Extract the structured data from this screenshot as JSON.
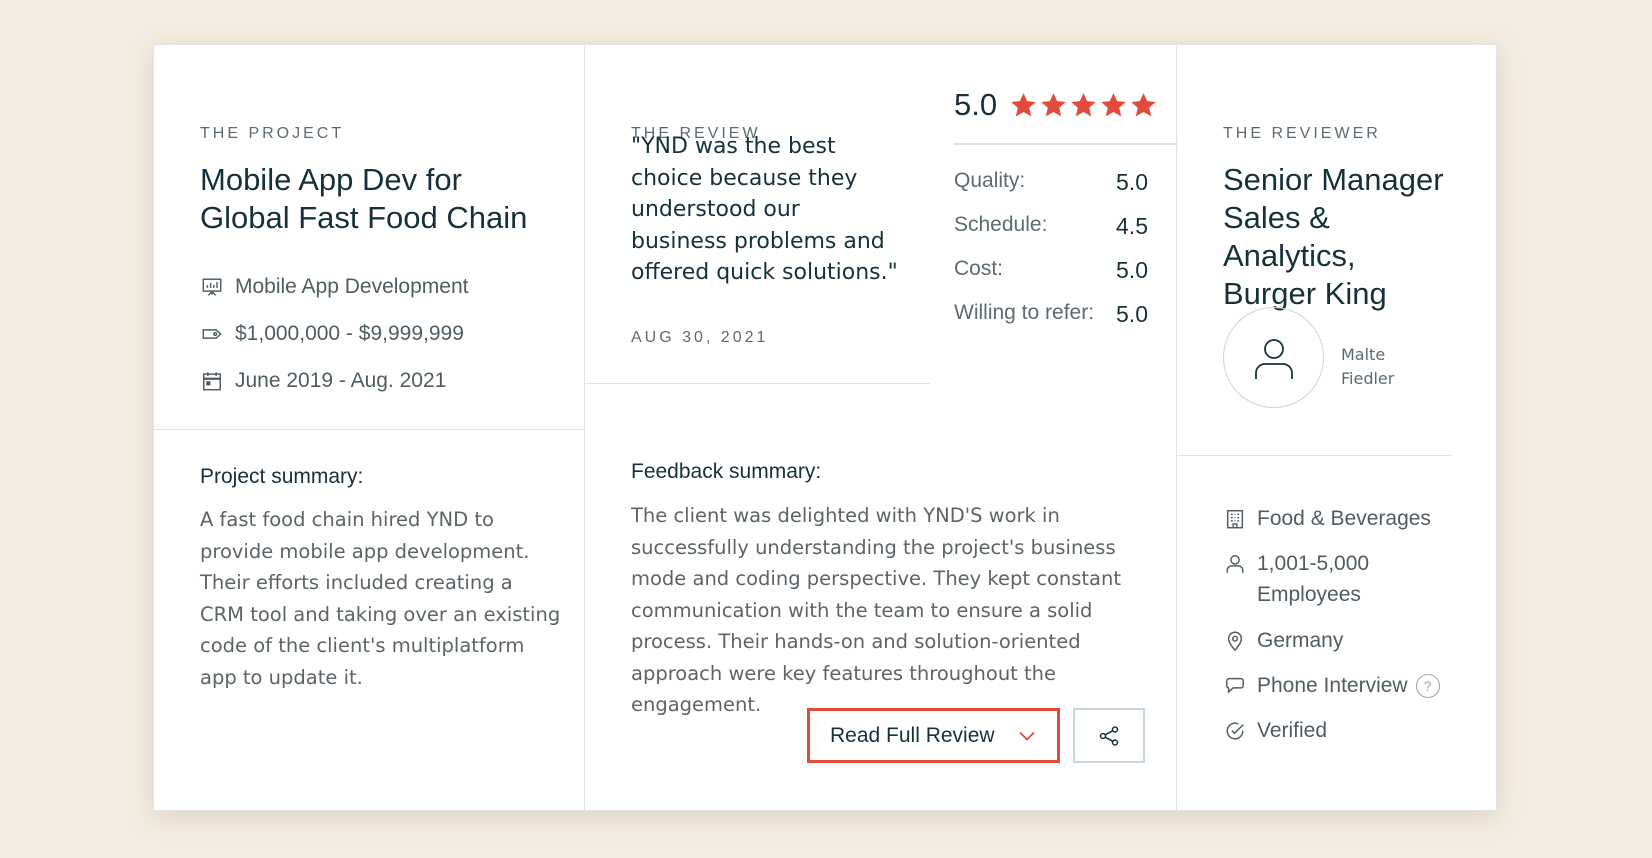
{
  "project": {
    "eyebrow": "THE PROJECT",
    "title_line1": "Mobile App Dev for",
    "title_line2": "Global Fast Food Chain",
    "service": "Mobile App Development",
    "budget": "$1,000,000 - $9,999,999",
    "dates": "June 2019 - Aug. 2021",
    "summary_title": "Project summary:",
    "summary_lines": [
      "A fast food chain hired YND to",
      "provide mobile app development.",
      "Their efforts included creating a",
      "CRM tool and taking over an existing",
      "code of the client's multiplatform",
      "app to update it."
    ]
  },
  "review": {
    "eyebrow": "THE REVIEW",
    "quote_lines": [
      "\"YND was the best",
      "choice because they",
      "understood our",
      "business problems and",
      "offered quick solutions.\""
    ],
    "date": "AUG 30, 2021",
    "overall_score": "5.0",
    "stars": 5,
    "ratings": [
      {
        "label": "Quality:",
        "value": "5.0"
      },
      {
        "label": "Schedule:",
        "value": "4.5"
      },
      {
        "label": "Cost:",
        "value": "5.0"
      },
      {
        "label": "Willing to refer:",
        "value": "5.0"
      }
    ],
    "feedback_title": "Feedback summary:",
    "feedback_lines": [
      "The client was delighted with YND'S work in",
      "successfully understanding the project's business",
      "mode and coding perspective. They kept constant",
      "communication with the team to ensure a solid",
      "process. Their hands-on and solution-oriented",
      "approach were key features throughout the",
      "engagement."
    ],
    "read_full_label": "Read Full Review"
  },
  "reviewer": {
    "eyebrow": "THE REVIEWER",
    "title_lines": [
      "Senior Manager",
      "Sales &",
      "Analytics,",
      "Burger King"
    ],
    "name_line1": "Malte",
    "name_line2": "Fiedler",
    "industry": "Food & Beverages",
    "size_line1": "1,001-5,000",
    "size_line2": "Employees",
    "location": "Germany",
    "interview": "Phone Interview",
    "help": "?",
    "verified": "Verified"
  },
  "colors": {
    "background": "#f4ece0",
    "accent_red": "#e24a3b",
    "heading": "#17313b",
    "muted": "#5c6b72"
  },
  "icons": [
    "presentation-icon",
    "price-tag-icon",
    "calendar-icon",
    "star-icon",
    "chevron-down-icon",
    "share-icon",
    "user-avatar-icon",
    "building-icon",
    "person-icon",
    "location-pin-icon",
    "chat-bubble-icon",
    "help-circle-icon",
    "check-circle-icon"
  ]
}
